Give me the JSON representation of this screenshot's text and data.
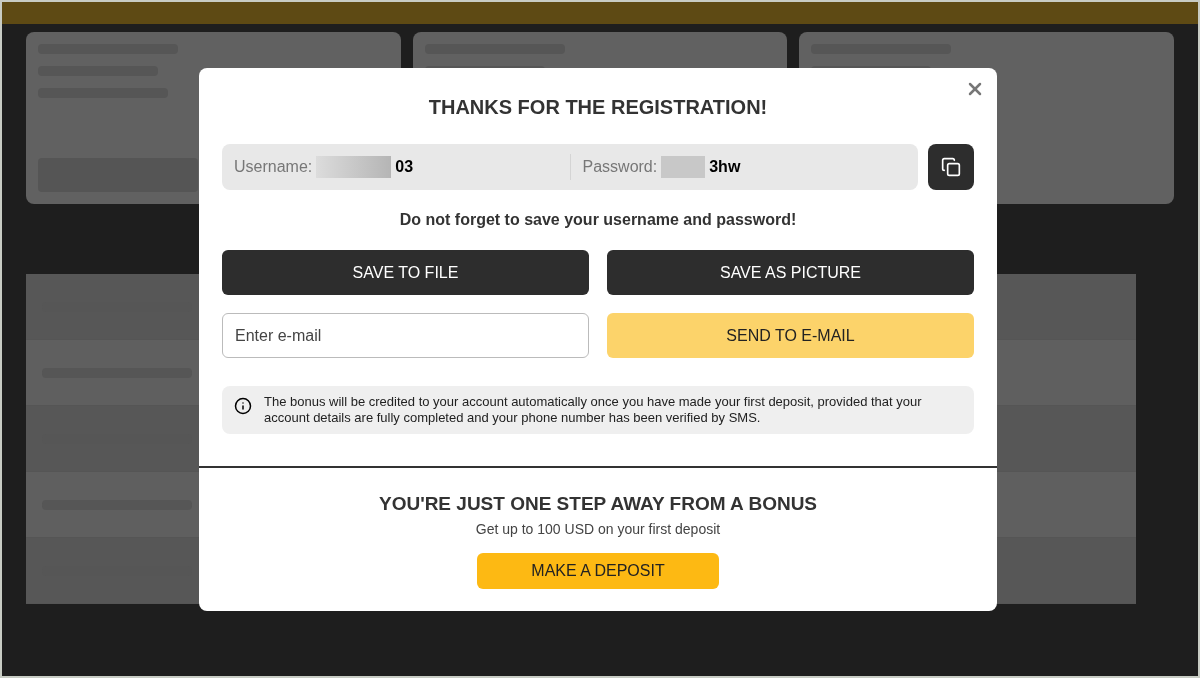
{
  "modal": {
    "title": "THANKS FOR THE REGISTRATION!",
    "username": {
      "label": "Username:",
      "value": "03"
    },
    "password": {
      "label": "Password:",
      "value": "3hw"
    },
    "reminder": "Do not forget to save your username and password!",
    "buttons": [
      {
        "label": "SAVE TO FILE"
      },
      {
        "label": "SAVE AS PICTURE"
      }
    ],
    "email": {
      "placeholder": "Enter e-mail",
      "button": "SEND TO E-MAIL"
    },
    "notice": "The bonus will be credited to your account automatically once you have made your first deposit, provided that your account details are fully completed and your phone number has been verified by SMS.",
    "bonus": {
      "title": "YOU'RE JUST ONE STEP AWAY FROM A BONUS",
      "subtitle": "Get up to 100 USD on your first deposit",
      "button": "MAKE A DEPOSIT"
    }
  }
}
